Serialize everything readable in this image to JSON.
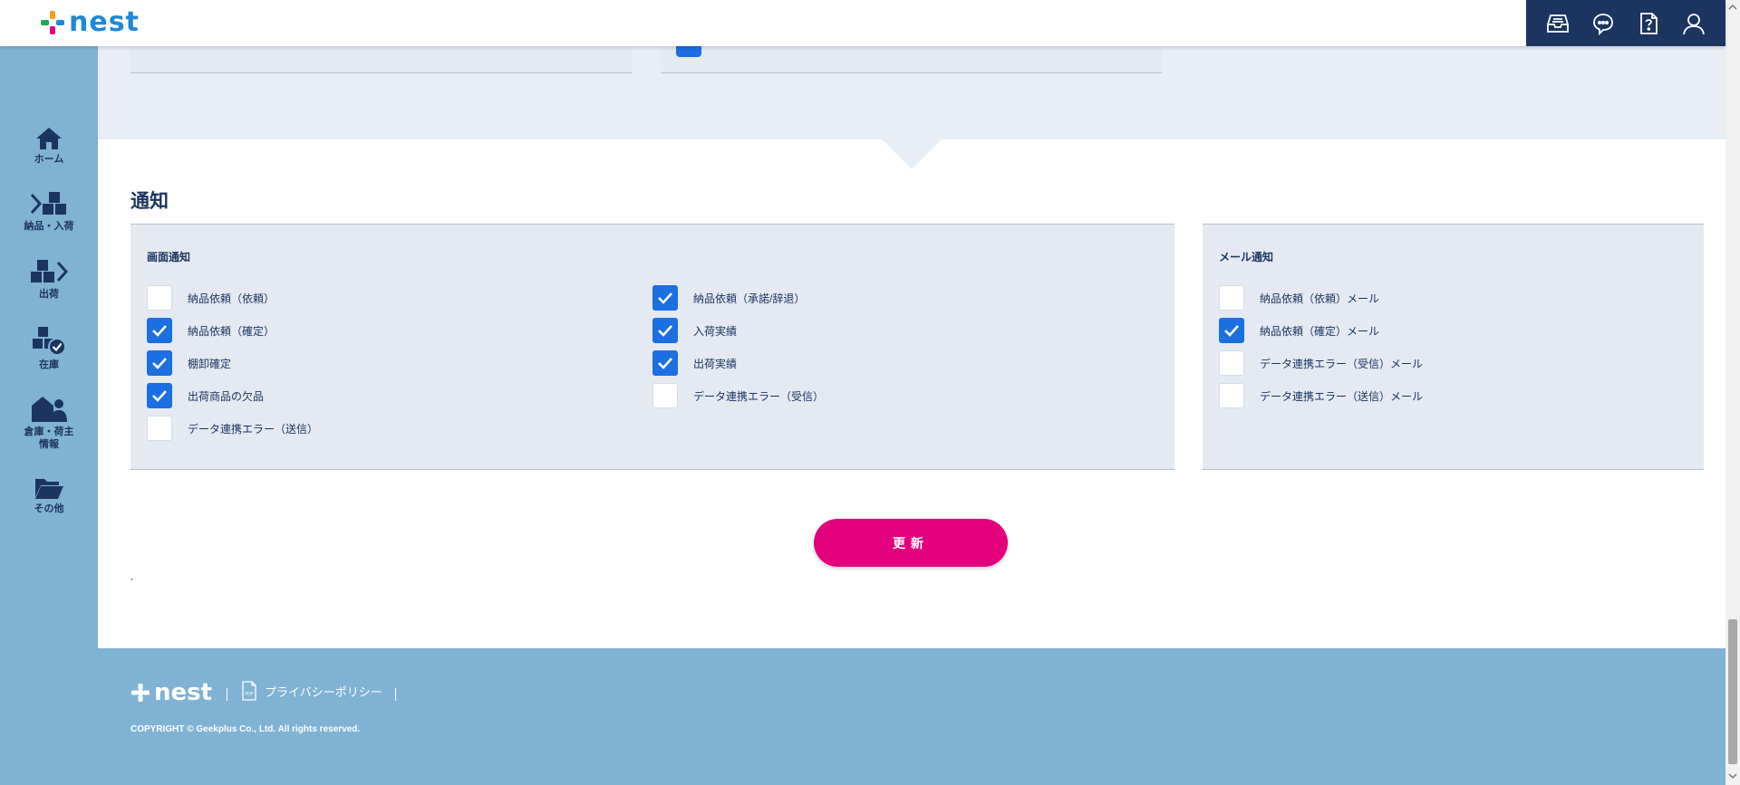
{
  "header": {
    "logo_text": "nest",
    "icons": [
      "inbox-icon",
      "chat-icon",
      "help-icon",
      "user-icon"
    ]
  },
  "sidebar": {
    "items": [
      {
        "label": "ホーム",
        "icon": "home-icon"
      },
      {
        "label": "納品・入荷",
        "icon": "inbound-icon"
      },
      {
        "label": "出荷",
        "icon": "outbound-icon"
      },
      {
        "label": "在庫",
        "icon": "inventory-icon"
      },
      {
        "label": "倉庫・荷主情報",
        "icon": "warehouse-icon"
      },
      {
        "label": "その他",
        "icon": "folder-icon"
      }
    ]
  },
  "notification": {
    "title": "通知",
    "screen": {
      "title": "画面通知",
      "options": [
        {
          "label": "納品依頼（依頼）",
          "checked": false
        },
        {
          "label": "納品依頼（確定）",
          "checked": true
        },
        {
          "label": "棚卸確定",
          "checked": true
        },
        {
          "label": "出荷商品の欠品",
          "checked": true
        },
        {
          "label": "データ連携エラー（送信）",
          "checked": false
        },
        {
          "label": "納品依頼（承諾/辞退）",
          "checked": true
        },
        {
          "label": "入荷実績",
          "checked": true
        },
        {
          "label": "出荷実績",
          "checked": true
        },
        {
          "label": "データ連携エラー（受信）",
          "checked": false
        }
      ]
    },
    "mail": {
      "title": "メール通知",
      "options": [
        {
          "label": "納品依頼（依頼）メール",
          "checked": false
        },
        {
          "label": "納品依頼（確定）メール",
          "checked": true
        },
        {
          "label": "データ連携エラー（受信）メール",
          "checked": false
        },
        {
          "label": "データ連携エラー（送信）メール",
          "checked": false
        }
      ]
    },
    "update_label": "更新",
    "mark": ","
  },
  "footer": {
    "logo_text": "nest",
    "privacy_label": "プライバシーポリシー",
    "copyright": "COPYRIGHT © Geekplus Co., Ltd. All rights reserved."
  },
  "colors": {
    "accent": "#1c6fe0",
    "brand_pink": "#e3007d",
    "navy": "#1c3560",
    "sidebar_bg": "#80b2d3"
  }
}
